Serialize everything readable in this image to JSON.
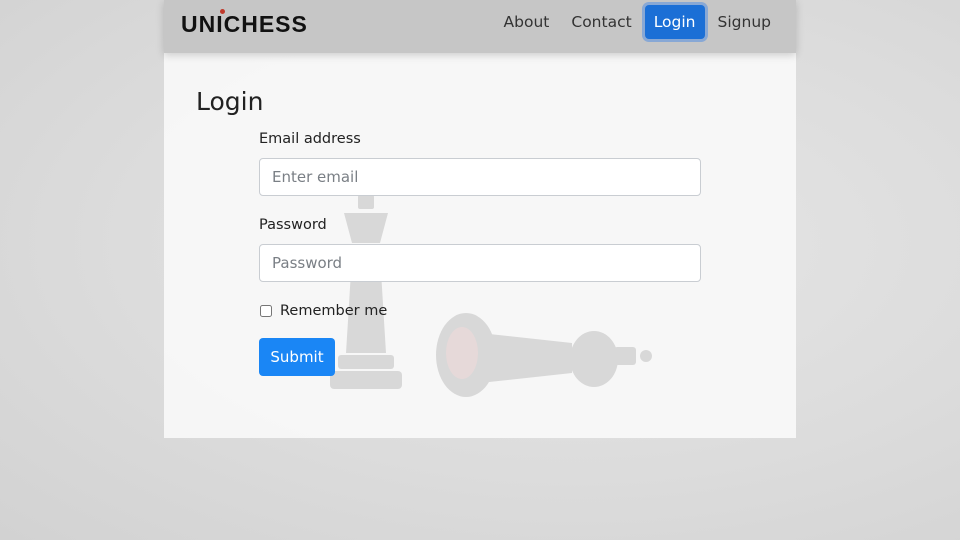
{
  "header": {
    "brand_pre": "UN",
    "brand_i": "I",
    "brand_post": "CHESS",
    "nav": [
      {
        "label": "About",
        "active": false
      },
      {
        "label": "Contact",
        "active": false
      },
      {
        "label": "Login",
        "active": true
      },
      {
        "label": "Signup",
        "active": false
      }
    ]
  },
  "form": {
    "title": "Login",
    "email_label": "Email address",
    "email_placeholder": "Enter email",
    "email_value": "",
    "password_label": "Password",
    "password_placeholder": "Password",
    "password_value": "",
    "remember_label": "Remember me",
    "remember_checked": false,
    "submit_label": "Submit"
  },
  "colors": {
    "active_nav": "#1b6fd6",
    "submit": "#1a86f5",
    "navbar_bg": "#c6c6c6"
  },
  "icons": {
    "background": "chess-pieces-watermark"
  }
}
